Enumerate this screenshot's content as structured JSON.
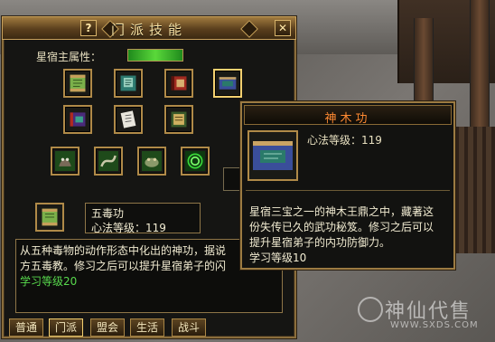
{
  "window": {
    "title": "门派技能",
    "help_label": "?",
    "close_label": "✕"
  },
  "attribute": {
    "label": "星宿主属性："
  },
  "skill_grid": [
    {
      "name": "scroll-green-icon"
    },
    {
      "name": "book-teal-icon"
    },
    {
      "name": "book-red-icon"
    },
    {
      "name": "book-blue-icon"
    },
    {
      "name": "book-purple-icon"
    },
    {
      "name": "scroll-white-icon"
    },
    {
      "name": "scroll-gold-icon"
    },
    {
      "name": "poison-creature-icon"
    },
    {
      "name": "serpent-icon"
    },
    {
      "name": "toad-icon"
    },
    {
      "name": "swirl-icon"
    }
  ],
  "selected": {
    "name": "五毒功",
    "level_label": "心法等级：119"
  },
  "description": {
    "line1": "从五种毒物的动作形态中化出的神功，据说",
    "line2": "方五毒教。修习之后可以提升星宿弟子的闪",
    "learn_level": "学习等级20"
  },
  "tabs": [
    "普通",
    "门派",
    "盟会",
    "生活",
    "战斗"
  ],
  "tooltip": {
    "title": "神木功",
    "level_label": "心法等级：119",
    "desc_line1": "星宿三宝之一的神木王鼎之中，藏著这",
    "desc_line2": "份失传已久的武功秘笈。修习之后可以",
    "desc_line3": "提升星宿弟子的内功防御力。",
    "learn_level": "学习等级10"
  },
  "watermark": {
    "text": "神仙代售",
    "url": "WWW.SXDS.COM"
  },
  "colors": {
    "accent_gold": "#8a6d3b",
    "tooltip_title": "#ff8a32",
    "learn_green": "#57d84c"
  }
}
